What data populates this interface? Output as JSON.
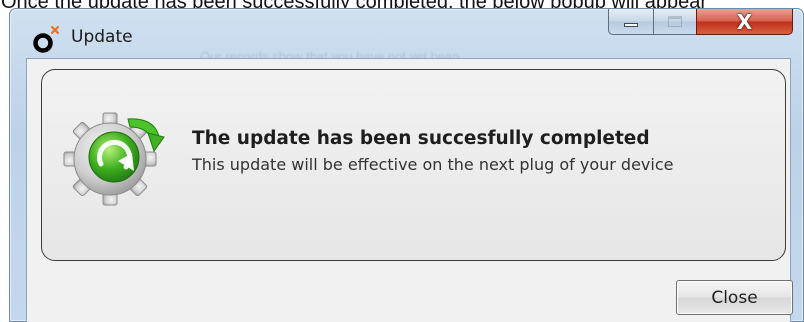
{
  "document": {
    "caption": "Once the update has been successfully completed, the below popup will appear"
  },
  "window": {
    "title": "Update",
    "logo_icon": "app-logo-icon",
    "background_ghost_text": "Our records show that you have not yet been"
  },
  "caption_buttons": {
    "minimize_icon": "minimize-icon",
    "maximize_icon": "maximize-icon",
    "close_icon": "close-icon",
    "close_glyph": "X"
  },
  "dialog": {
    "icon": "update-gear-icon",
    "headline": "The update has been succesfully completed",
    "detail": "This update will be effective on the next plug of your device",
    "close_label": "Close"
  },
  "colors": {
    "titlebar_gradient_start": "#cfe0f0",
    "close_button_red": "#c0301d",
    "gear_grey": "#cfcfcf",
    "arrow_green": "#3fb01f",
    "logo_orange": "#f26a1b"
  }
}
